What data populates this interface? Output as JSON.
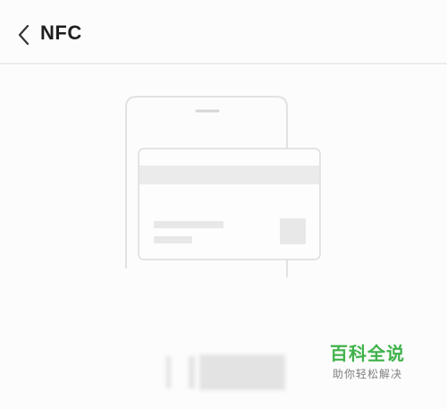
{
  "header": {
    "title": "NFC",
    "back_icon": "chevron-left-icon"
  },
  "watermark": {
    "main": "百科全说",
    "sub": "助你轻松解决",
    "color": "#3fb24a"
  }
}
